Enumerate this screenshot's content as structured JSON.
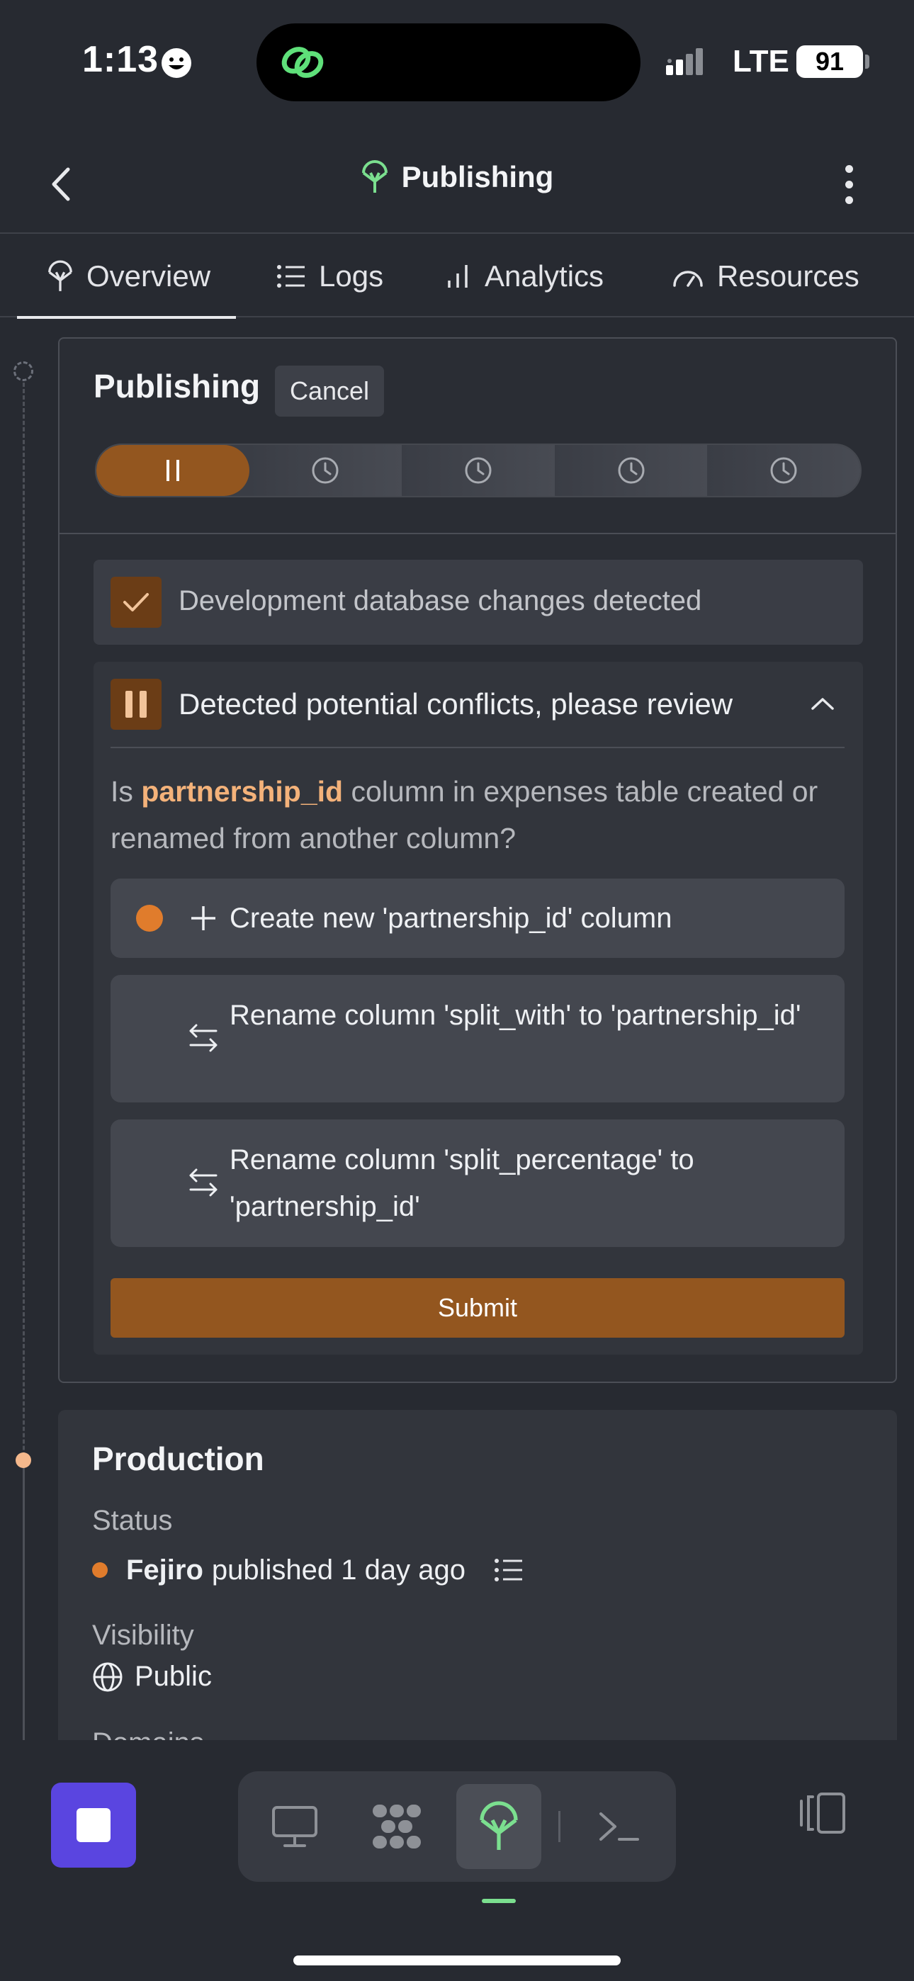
{
  "status_bar": {
    "time": "1:13",
    "network": "LTE",
    "battery": "91"
  },
  "header": {
    "title": "Publishing"
  },
  "tabs": [
    {
      "label": "Overview",
      "icon": "antenna-icon",
      "active": true
    },
    {
      "label": "Logs",
      "icon": "list-icon"
    },
    {
      "label": "Analytics",
      "icon": "bar-chart-icon"
    },
    {
      "label": "Resources",
      "icon": "gauge-icon"
    }
  ],
  "publishing": {
    "title": "Publishing",
    "cancel_label": "Cancel",
    "steps": [
      "current-paused",
      "pending",
      "pending",
      "pending",
      "pending"
    ],
    "detected_text": "Development database changes detected",
    "conflict": {
      "title": "Detected potential conflicts, please review",
      "question_prefix": "Is",
      "question_highlight": "partnership_id",
      "question_suffix": "column in expenses table created or renamed from another column?",
      "options": [
        {
          "label": "Create new 'partnership_id' column",
          "icon": "plus-icon",
          "selected": true
        },
        {
          "label": "Rename column 'split_with' to 'partnership_id'",
          "icon": "swap-icon",
          "selected": false
        },
        {
          "label": "Rename column 'split_percentage' to 'partnership_id'",
          "icon": "swap-icon",
          "selected": false
        }
      ],
      "submit_label": "Submit"
    }
  },
  "production": {
    "title": "Production",
    "status_label": "Status",
    "status_user": "Fejiro",
    "status_text": "published 1 day ago",
    "visibility_label": "Visibility",
    "visibility_value": "Public",
    "cut_label": "Domains"
  },
  "colors": {
    "accent": "#93561f",
    "brand": "#5a45e0",
    "active_green": "#7bdf8f",
    "status_orange": "#e07c2c"
  }
}
